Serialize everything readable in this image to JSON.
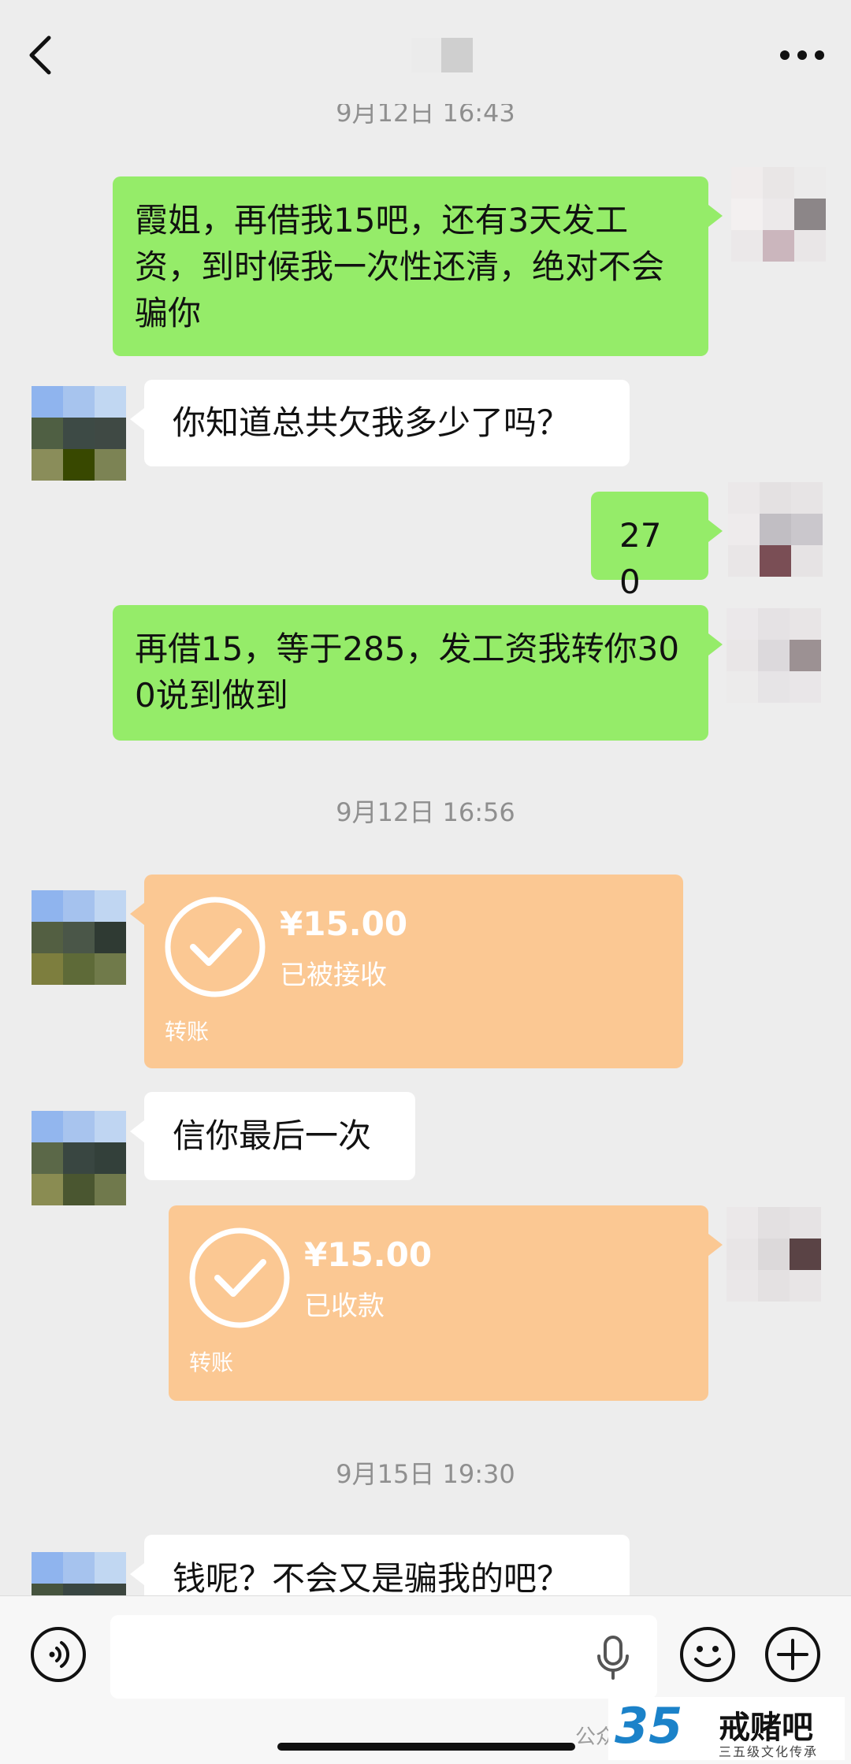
{
  "header": {
    "back_icon": "chevron-left-icon",
    "title": "",
    "more_icon": "more-dots-icon"
  },
  "messages": {
    "time_1": "9月12日 16:43",
    "msg_1": "霞姐，再借我15吧，还有3天发工资，到时候我一次性还清，绝对不会骗你",
    "msg_2": "你知道总共欠我多少了吗？",
    "msg_3": "270",
    "msg_4": "再借15，等于285，发工资我转你300说到做到",
    "time_2": "9月12日 16:56",
    "transfer_1": {
      "amount": "¥15.00",
      "status": "已被接收",
      "label": "转账"
    },
    "msg_5": "信你最后一次",
    "transfer_2": {
      "amount": "¥15.00",
      "status": "已收款",
      "label": "转账"
    },
    "time_3": "9月15日 19:30",
    "msg_6": "钱呢？不会又是骗我的吧？"
  },
  "footer": {
    "voice_icon": "voice-input-icon",
    "input_value": "",
    "mic_icon": "microphone-icon",
    "emoji_icon": "emoji-icon",
    "plus_icon": "plus-icon"
  },
  "watermark": {
    "logo": "35",
    "title": "戒赌吧",
    "subtitle": "三五级文化传承",
    "left_text": "公众号"
  },
  "colors": {
    "background": "#ededed",
    "my_bubble": "#95ec69",
    "other_bubble": "#ffffff",
    "transfer": "#fbc893"
  }
}
